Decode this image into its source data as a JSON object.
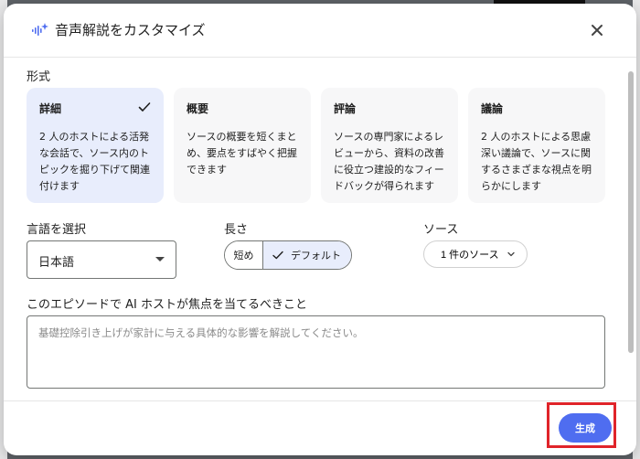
{
  "dialog": {
    "title": "音声解説をカスタマイズ",
    "icons": {
      "header": "audio-sparkle-icon",
      "close": "close-icon"
    }
  },
  "format": {
    "label": "形式",
    "selected_index": 0,
    "cards": [
      {
        "title": "詳細",
        "description": "2 人のホストによる活発な会話で、ソース内のトピックを掘り下げて関連付けます",
        "selected": true
      },
      {
        "title": "概要",
        "description": "ソースの概要を短くまとめ、要点をすばやく把握できます",
        "selected": false
      },
      {
        "title": "評論",
        "description": "ソースの専門家によるレビューから、資料の改善に役立つ建設的なフィードバックが得られます",
        "selected": false
      },
      {
        "title": "議論",
        "description": "2 人のホストによる思慮深い議論で、ソースに関するさまざまな視点を明らかにします",
        "selected": false
      }
    ]
  },
  "language": {
    "label": "言語を選択",
    "value": "日本語"
  },
  "length": {
    "label": "長さ",
    "options": [
      "短め",
      "デフォルト"
    ],
    "selected": "デフォルト"
  },
  "source": {
    "label": "ソース",
    "button_label": "1 件のソース"
  },
  "focus": {
    "label": "このエピソードで AI ホストが焦点を当てるべきこと",
    "placeholder": "基礎控除引き上げが家計に与える具体的な影響を解説してください。",
    "value": ""
  },
  "footer": {
    "generate_label": "生成"
  },
  "colors": {
    "accent": "#4f6df0",
    "selected_bg": "#e8edfc",
    "highlight": "#e0242a"
  }
}
